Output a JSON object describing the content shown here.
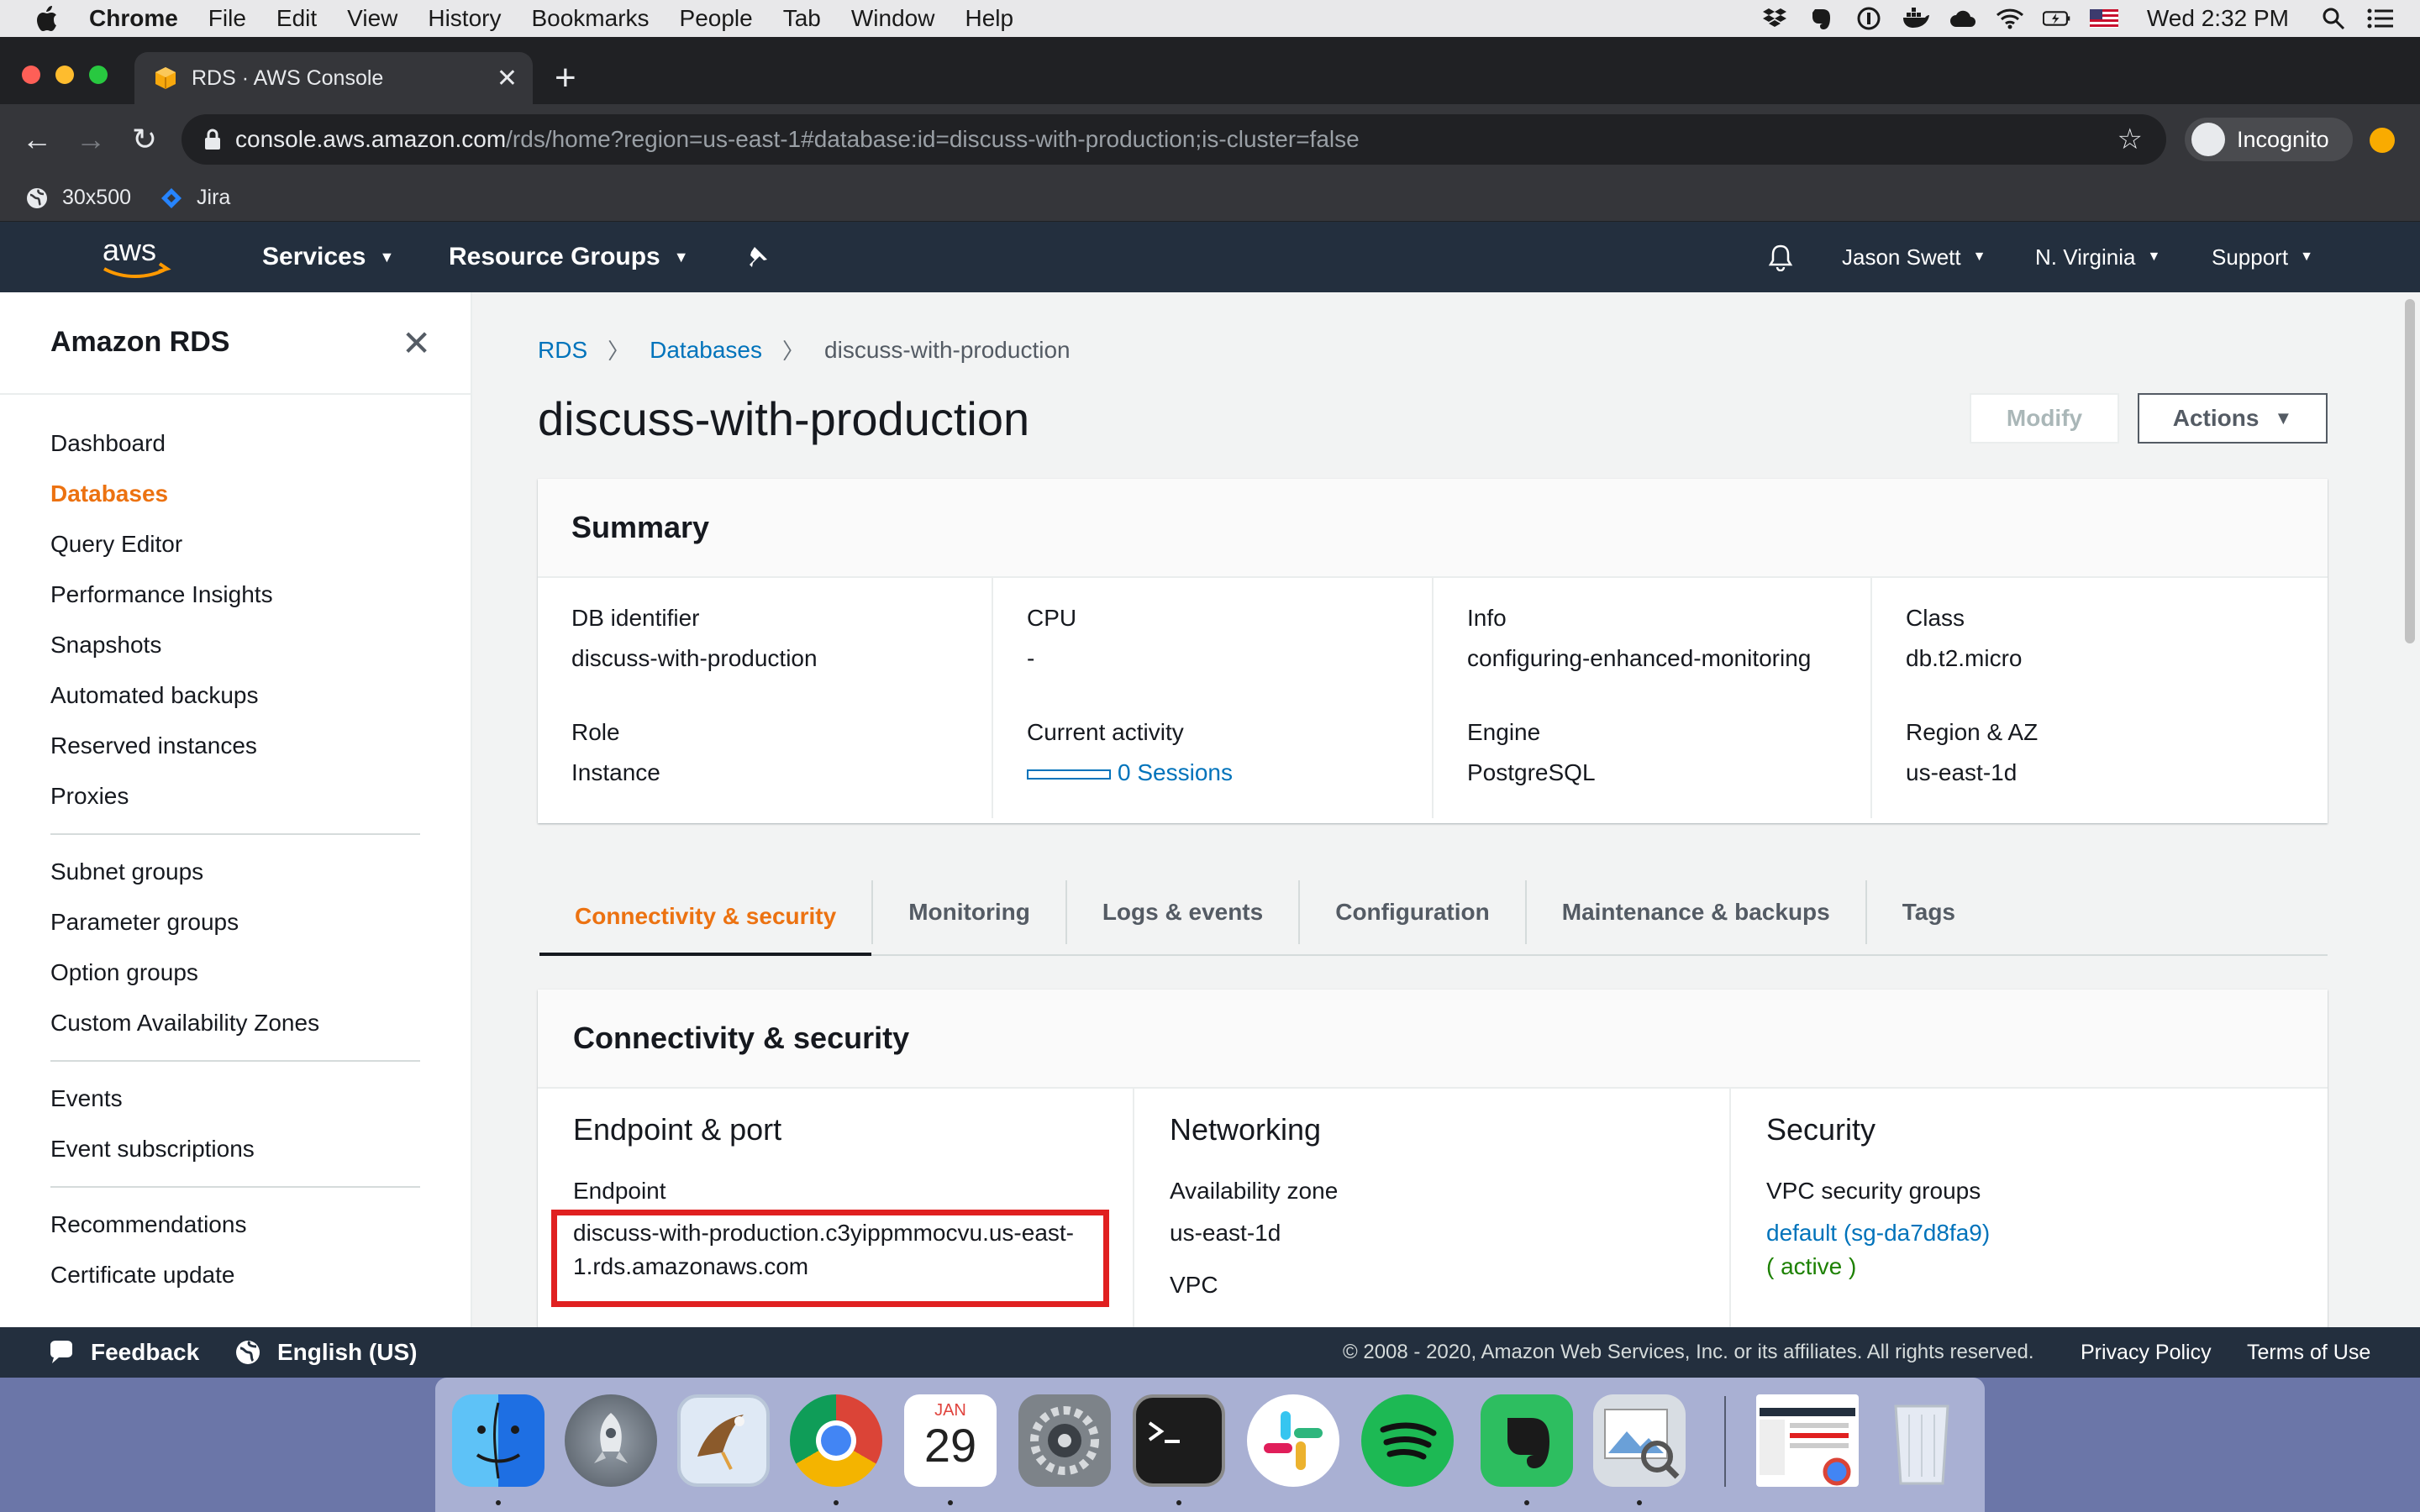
{
  "menubar": {
    "app": "Chrome",
    "items": [
      "File",
      "Edit",
      "View",
      "History",
      "Bookmarks",
      "People",
      "Tab",
      "Window",
      "Help"
    ],
    "clock": "Wed 2:32 PM"
  },
  "browser": {
    "tab_title": "RDS · AWS Console",
    "url_host": "console.aws.amazon.com",
    "url_path": "/rds/home?region=us-east-1#database:id=discuss-with-production;is-cluster=false",
    "profile": "Incognito",
    "bookmarks": [
      "30x500",
      "Jira"
    ]
  },
  "aws_nav": {
    "services": "Services",
    "resource_groups": "Resource Groups",
    "user": "Jason Swett",
    "region": "N. Virginia",
    "support": "Support"
  },
  "sidebar": {
    "title": "Amazon RDS",
    "groups": [
      [
        {
          "label": "Dashboard",
          "active": false
        },
        {
          "label": "Databases",
          "active": true
        },
        {
          "label": "Query Editor",
          "active": false
        },
        {
          "label": "Performance Insights",
          "active": false
        },
        {
          "label": "Snapshots",
          "active": false
        },
        {
          "label": "Automated backups",
          "active": false
        },
        {
          "label": "Reserved instances",
          "active": false
        },
        {
          "label": "Proxies",
          "active": false
        }
      ],
      [
        {
          "label": "Subnet groups",
          "active": false
        },
        {
          "label": "Parameter groups",
          "active": false
        },
        {
          "label": "Option groups",
          "active": false
        },
        {
          "label": "Custom Availability Zones",
          "active": false
        }
      ],
      [
        {
          "label": "Events",
          "active": false
        },
        {
          "label": "Event subscriptions",
          "active": false
        }
      ],
      [
        {
          "label": "Recommendations",
          "active": false
        },
        {
          "label": "Certificate update",
          "active": false
        }
      ]
    ]
  },
  "breadcrumb": {
    "root": "RDS",
    "section": "Databases",
    "current": "discuss-with-production"
  },
  "page": {
    "title": "discuss-with-production",
    "modify": "Modify",
    "actions": "Actions"
  },
  "summary": {
    "heading": "Summary",
    "db_identifier_label": "DB identifier",
    "db_identifier": "discuss-with-production",
    "role_label": "Role",
    "role": "Instance",
    "cpu_label": "CPU",
    "cpu": "-",
    "activity_label": "Current activity",
    "activity": "0 Sessions",
    "info_label": "Info",
    "info": "configuring-enhanced-monitoring",
    "engine_label": "Engine",
    "engine": "PostgreSQL",
    "class_label": "Class",
    "class": "db.t2.micro",
    "region_label": "Region & AZ",
    "region": "us-east-1d"
  },
  "tabs": [
    "Connectivity & security",
    "Monitoring",
    "Logs & events",
    "Configuration",
    "Maintenance & backups",
    "Tags"
  ],
  "connectivity": {
    "heading": "Connectivity & security",
    "endpoint_heading": "Endpoint & port",
    "endpoint_label": "Endpoint",
    "endpoint_line1": "discuss-with-production.c3yippmmocvu.us-east-",
    "endpoint_line2": "1.rds.amazonaws.com",
    "networking_heading": "Networking",
    "az_label": "Availability zone",
    "az": "us-east-1d",
    "vpc_label": "VPC",
    "security_heading": "Security",
    "sg_label": "VPC security groups",
    "sg": "default (sg-da7d8fa9)",
    "sg_status": "( active )"
  },
  "footer": {
    "feedback": "Feedback",
    "language": "English (US)",
    "copyright": "© 2008 - 2020, Amazon Web Services, Inc. or its affiliates. All rights reserved.",
    "privacy": "Privacy Policy",
    "terms": "Terms of Use"
  },
  "dock": {
    "calendar_month": "JAN",
    "calendar_day": "29"
  },
  "colors": {
    "aws_nav": "#232f3e",
    "active_orange": "#ec7211",
    "link_blue": "#0073bb",
    "highlight_red": "#e02020"
  }
}
